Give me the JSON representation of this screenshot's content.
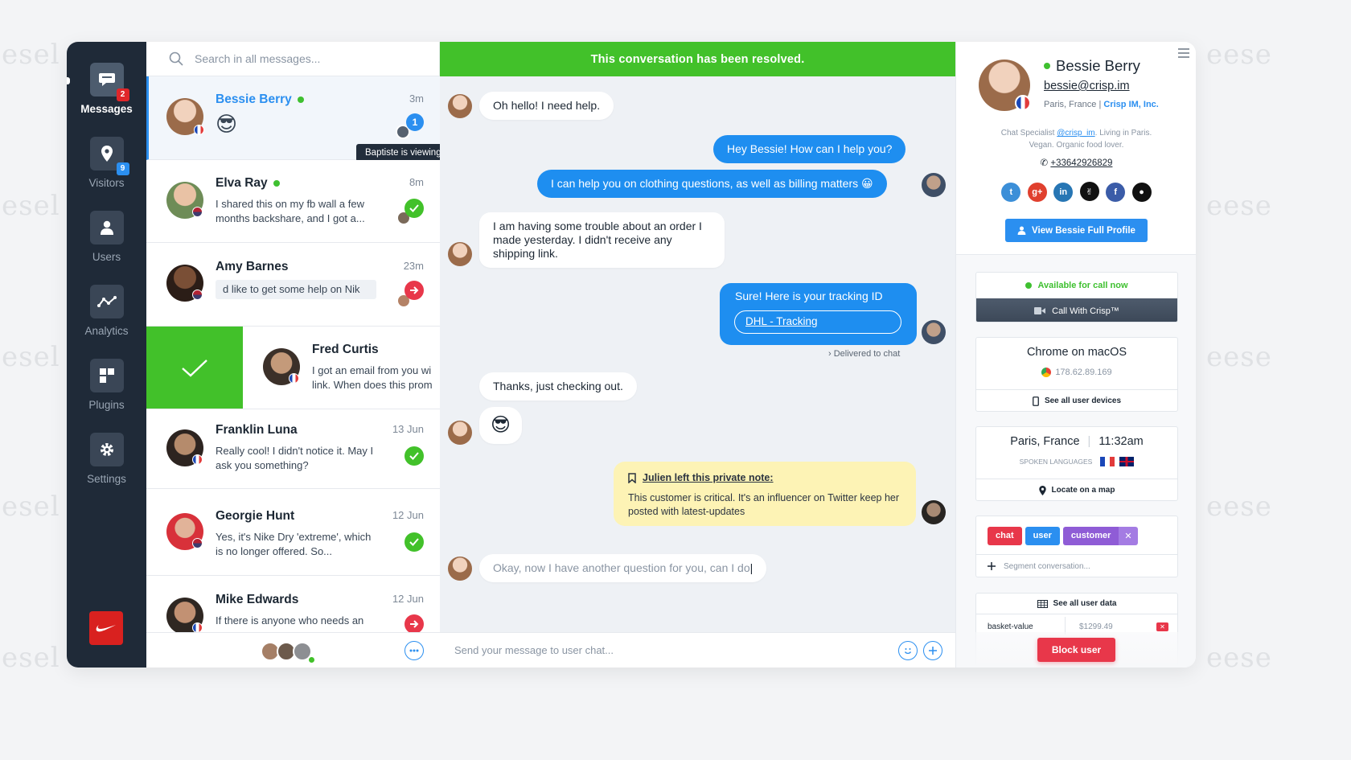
{
  "watermark": {
    "left": "esel",
    "right": "eese"
  },
  "nav": {
    "items": [
      {
        "label": "Messages",
        "badge": "2",
        "icon": "chat-icon"
      },
      {
        "label": "Visitors",
        "badge": "9",
        "icon": "location-pin-icon"
      },
      {
        "label": "Users",
        "icon": "user-icon"
      },
      {
        "label": "Analytics",
        "icon": "analytics-icon"
      },
      {
        "label": "Plugins",
        "icon": "plugins-icon"
      },
      {
        "label": "Settings",
        "icon": "gear-icon"
      }
    ],
    "badge_colors": {
      "messages": "#e0262a",
      "visitors": "#2b8ff0"
    }
  },
  "search": {
    "placeholder": "Search in all messages..."
  },
  "conversations": [
    {
      "name": "Bessie Berry",
      "time": "3m",
      "message": "😎",
      "online": true,
      "unread": "1",
      "tooltip": "Baptiste is viewing"
    },
    {
      "name": "Elva Ray",
      "time": "8m",
      "message": "I shared this on my fb wall a few months backshare, and I got a...",
      "online": true
    },
    {
      "name": "Amy Barnes",
      "time": "23m",
      "message": "d like to get some help on Nik"
    },
    {
      "name": "Fred Curtis",
      "message": "I got an email from you wi link. When does this prom"
    },
    {
      "name": "Franklin Luna",
      "time": "13 Jun",
      "message": "Really cool! I didn't notice it. May I ask you something?"
    },
    {
      "name": "Georgie Hunt",
      "time": "12 Jun",
      "message": "Yes, it's Nike Dry 'extreme', which is no longer offered. So..."
    },
    {
      "name": "Mike Edwards",
      "time": "12 Jun",
      "message": "If there is anyone who needs an"
    }
  ],
  "chat": {
    "banner": "This conversation has been resolved.",
    "messages": [
      "Oh hello! I need help.",
      "Hey Bessie! How can I help you?",
      "I can help you on clothing questions, as well as billing matters 😀",
      "I am having some trouble about an order I made yesterday. I didn't receive any shipping link.",
      "Sure! Here is your tracking ID",
      "DHL - Tracking",
      "Delivered to chat",
      "Thanks, just checking out.",
      "😎"
    ],
    "note": {
      "title": "Julien left this private note:",
      "body": "This customer is critical. It's an influencer on Twitter keep her posted with latest-updates"
    },
    "typing": "Okay, now I have another question for you, can I do",
    "composer_placeholder": "Send your message to user chat..."
  },
  "profile": {
    "name": "Bessie Berry",
    "email": "bessie@crisp.im",
    "location": "Paris, France",
    "company": "Crisp IM, Inc.",
    "bio_1": "Chat Specialist ",
    "bio_handle": "@crisp_im",
    "bio_2": ". Living in Paris.",
    "bio_3": "Vegan. Organic food lover.",
    "phone": "+33642926829",
    "socials": [
      "twitter-icon",
      "google-plus-icon",
      "linkedin-icon",
      "snapchat-icon",
      "facebook-icon",
      "github-icon"
    ],
    "view_profile": "View Bessie Full Profile",
    "availability": "Available for call now",
    "call_button": "Call With Crisp™",
    "browser": "Chrome on macOS",
    "ip": "178.62.89.169",
    "devices_link": "See all user devices",
    "city": "Paris, France",
    "local_time": "11:32am",
    "languages_label": "SPOKEN LANGUAGES",
    "map_link": "Locate on a map",
    "tags": [
      "chat",
      "user",
      "customer"
    ],
    "segment_placeholder": "Segment conversation...",
    "user_data_link": "See all user data",
    "data_key": "basket-value",
    "data_value": "$1299.49",
    "block_button": "Block user"
  },
  "colors": {
    "accent": "#2b8ff0",
    "resolved": "#42c12a",
    "danger": "#e8374a",
    "nav_bg": "#1f2a38",
    "note": "#fdf3b5"
  }
}
